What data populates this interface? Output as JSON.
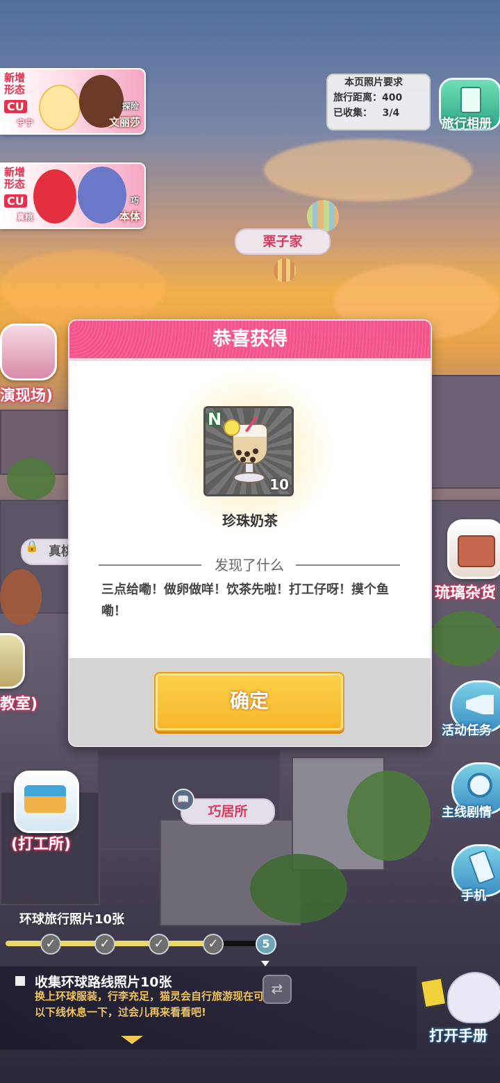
{
  "banners": [
    {
      "tag": "新增\n形态",
      "cu": "CU",
      "left_name": "宁宁",
      "right_name": "文丽莎",
      "right_sub": "探险"
    },
    {
      "tag": "新增\n形态",
      "cu": "CU",
      "left_name": "真桃",
      "right_name": "本体",
      "right_sub": "巧"
    }
  ],
  "photo_requirement": {
    "title": "本页照片要求",
    "distance": "旅行距离：400",
    "collected": "已收集：   3/4"
  },
  "album_button": {
    "label": "旅行相册",
    "icon": "photo-album-icon"
  },
  "map_labels": {
    "chestnut_home": "栗子家",
    "qiao_residence": "巧居所",
    "locked_place": "真桃"
  },
  "poi": {
    "performance": "演现场)",
    "classroom": "教室)",
    "work_place": "(打工所)",
    "glass_shop": "琉璃杂货"
  },
  "side_buttons": {
    "activity": "活动任务",
    "main_story": "主线剧情",
    "phone": "手机",
    "open_handbook": "打开手册"
  },
  "modal": {
    "title": "恭喜获得",
    "item": {
      "rarity": "N",
      "count": "10",
      "name": "珍珠奶茶"
    },
    "section_title": "发现了什么",
    "description": "三点给嘞！做卵做咩！饮茶先啦！打工仔呀！摸个鱼嘞！",
    "confirm": "确定"
  },
  "progress": {
    "title": "环球旅行照片10张",
    "completed_nodes": 4,
    "current_node": "5"
  },
  "task": {
    "title": "收集环球路线照片10张",
    "desc": "换上环球服装，行李充足，猫灵会自行旅游现在可以下线休息一下，过会儿再来看看吧!"
  },
  "colors": {
    "accent_pink": "#f4558d",
    "button_gold": "#f7b52a"
  }
}
